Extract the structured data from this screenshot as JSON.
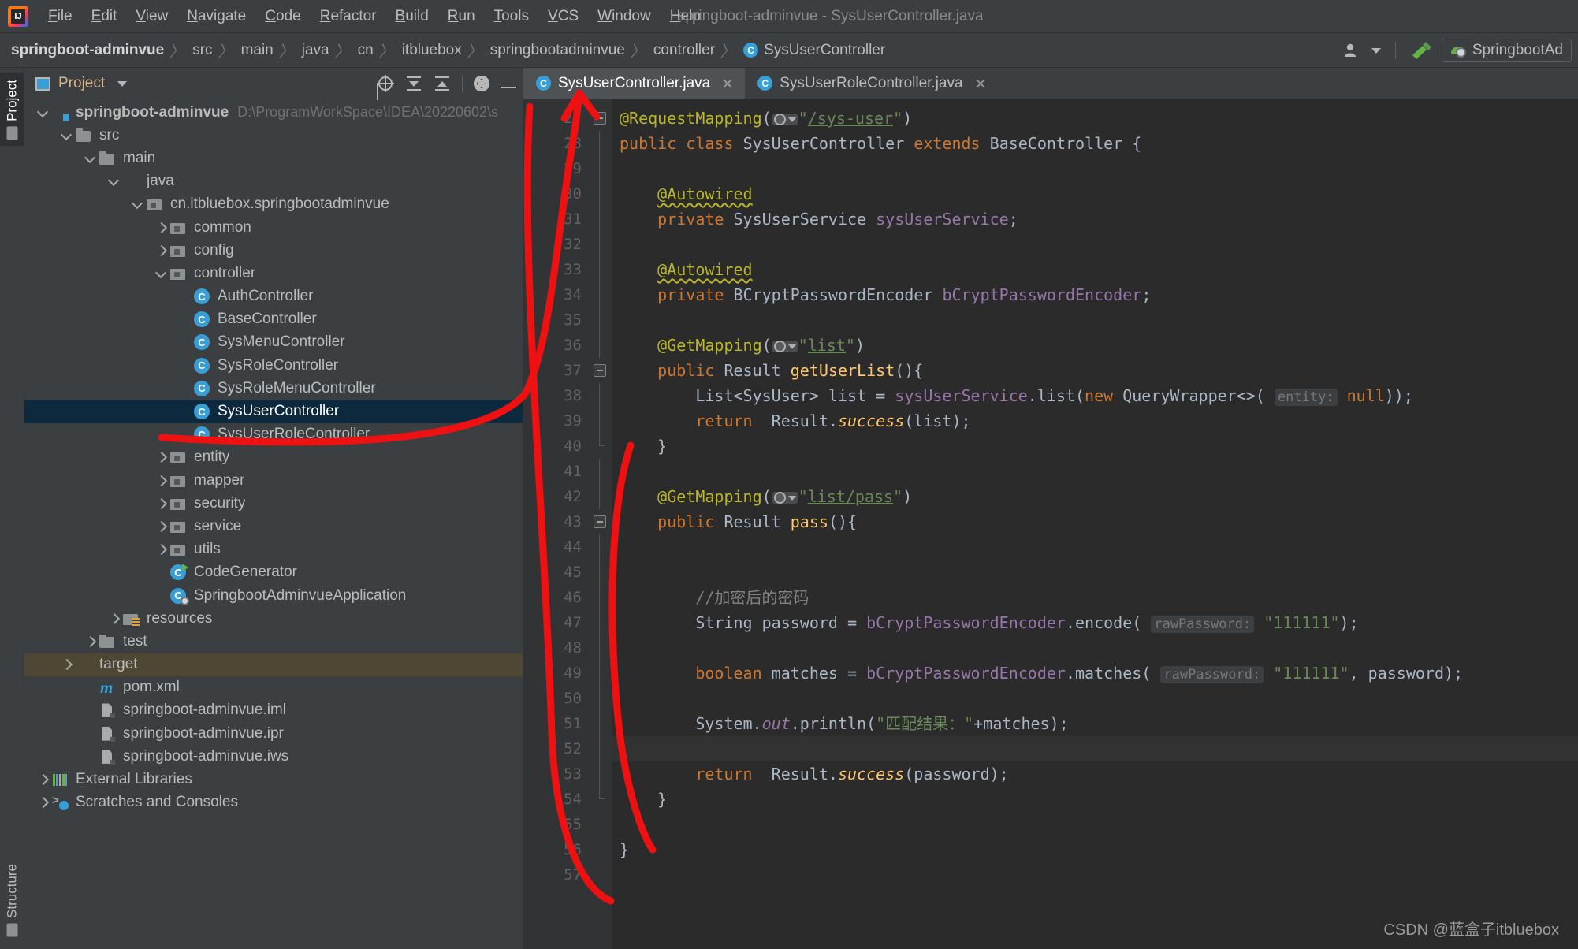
{
  "window": {
    "title": "springboot-adminvue - SysUserController.java",
    "logo_icon": "intellij-idea-logo"
  },
  "menu": [
    "File",
    "Edit",
    "View",
    "Navigate",
    "Code",
    "Refactor",
    "Build",
    "Run",
    "Tools",
    "VCS",
    "Window",
    "Help"
  ],
  "breadcrumb": [
    {
      "label": "springboot-adminvue",
      "icon": "",
      "root": true
    },
    {
      "label": "src",
      "icon": ""
    },
    {
      "label": "main",
      "icon": ""
    },
    {
      "label": "java",
      "icon": ""
    },
    {
      "label": "cn",
      "icon": ""
    },
    {
      "label": "itbluebox",
      "icon": ""
    },
    {
      "label": "springbootadminvue",
      "icon": ""
    },
    {
      "label": "controller",
      "icon": ""
    },
    {
      "label": "SysUserController",
      "icon": "class-icon"
    }
  ],
  "navbar_right": {
    "user_icon": "user-account-icon",
    "build_icon": "hammer-build-icon",
    "run_config": "SpringbootAd"
  },
  "tool_tabs": {
    "project": "Project",
    "structure": "Structure"
  },
  "project_panel": {
    "title": "Project",
    "tools": [
      {
        "name": "locate-icon"
      },
      {
        "name": "expand-all-icon"
      },
      {
        "name": "collapse-all-icon"
      },
      {
        "name": "settings-gear-icon"
      },
      {
        "name": "hide-panel-icon"
      }
    ],
    "tree": [
      {
        "depth": 0,
        "arrow": "d",
        "icon": "folder-mod",
        "label": "springboot-adminvue",
        "bold": true,
        "path": "D:\\ProgramWorkSpace\\IDEA\\20220602\\s",
        "state": ""
      },
      {
        "depth": 1,
        "arrow": "d",
        "icon": "folder",
        "label": "src",
        "state": ""
      },
      {
        "depth": 2,
        "arrow": "d",
        "icon": "folder",
        "label": "main",
        "state": ""
      },
      {
        "depth": 3,
        "arrow": "d",
        "icon": "folder-src",
        "label": "java",
        "state": ""
      },
      {
        "depth": 4,
        "arrow": "d",
        "icon": "pkg",
        "label": "cn.itbluebox.springbootadminvue",
        "state": ""
      },
      {
        "depth": 5,
        "arrow": "r",
        "icon": "pkg",
        "label": "common",
        "state": ""
      },
      {
        "depth": 5,
        "arrow": "r",
        "icon": "pkg",
        "label": "config",
        "state": ""
      },
      {
        "depth": 5,
        "arrow": "d",
        "icon": "pkg",
        "label": "controller",
        "state": ""
      },
      {
        "depth": 6,
        "arrow": "none",
        "icon": "cls",
        "label": "AuthController",
        "state": ""
      },
      {
        "depth": 6,
        "arrow": "none",
        "icon": "cls",
        "label": "BaseController",
        "state": ""
      },
      {
        "depth": 6,
        "arrow": "none",
        "icon": "cls",
        "label": "SysMenuController",
        "state": ""
      },
      {
        "depth": 6,
        "arrow": "none",
        "icon": "cls",
        "label": "SysRoleController",
        "state": ""
      },
      {
        "depth": 6,
        "arrow": "none",
        "icon": "cls",
        "label": "SysRoleMenuController",
        "state": ""
      },
      {
        "depth": 6,
        "arrow": "none",
        "icon": "cls",
        "label": "SysUserController",
        "state": "selected"
      },
      {
        "depth": 6,
        "arrow": "none",
        "icon": "cls",
        "label": "SysUserRoleController",
        "state": ""
      },
      {
        "depth": 5,
        "arrow": "r",
        "icon": "pkg",
        "label": "entity",
        "state": ""
      },
      {
        "depth": 5,
        "arrow": "r",
        "icon": "pkg",
        "label": "mapper",
        "state": ""
      },
      {
        "depth": 5,
        "arrow": "r",
        "icon": "pkg",
        "label": "security",
        "state": ""
      },
      {
        "depth": 5,
        "arrow": "r",
        "icon": "pkg",
        "label": "service",
        "state": ""
      },
      {
        "depth": 5,
        "arrow": "r",
        "icon": "pkg",
        "label": "utils",
        "state": ""
      },
      {
        "depth": 5,
        "arrow": "none",
        "icon": "cls-runnable",
        "label": "CodeGenerator",
        "state": ""
      },
      {
        "depth": 5,
        "arrow": "none",
        "icon": "cls-spring",
        "label": "SpringbootAdminvueApplication",
        "state": ""
      },
      {
        "depth": 3,
        "arrow": "r",
        "icon": "res",
        "label": "resources",
        "state": ""
      },
      {
        "depth": 2,
        "arrow": "r",
        "icon": "folder",
        "label": "test",
        "state": ""
      },
      {
        "depth": 1,
        "arrow": "r",
        "icon": "folder-target",
        "label": "target",
        "state": "highlight"
      },
      {
        "depth": 2,
        "arrow": "none",
        "icon": "maven",
        "label": "pom.xml",
        "state": ""
      },
      {
        "depth": 2,
        "arrow": "none",
        "icon": "file",
        "label": "springboot-adminvue.iml",
        "state": ""
      },
      {
        "depth": 2,
        "arrow": "none",
        "icon": "file",
        "label": "springboot-adminvue.ipr",
        "state": ""
      },
      {
        "depth": 2,
        "arrow": "none",
        "icon": "file",
        "label": "springboot-adminvue.iws",
        "state": ""
      },
      {
        "depth": 0,
        "arrow": "r",
        "icon": "libs",
        "label": "External Libraries",
        "state": ""
      },
      {
        "depth": 0,
        "arrow": "r",
        "icon": "scr",
        "label": "Scratches and Consoles",
        "state": ""
      }
    ]
  },
  "editor": {
    "tabs": [
      {
        "label": "SysUserController.java",
        "icon": "class-icon",
        "active": true,
        "closable": true
      },
      {
        "label": "SysUserRoleController.java",
        "icon": "class-icon",
        "active": false,
        "closable": true
      }
    ],
    "first_line_number": 27,
    "caret_line": 52,
    "lines": [
      {
        "n": 27,
        "marker": "",
        "fold": "minus",
        "html": "<span class=\"ann\">@RequestMapping</span>(<span class=\"globe\"><span class=\"g1\"></span><span class=\"g2\"></span></span><span class=\"str\">\"</span><span class=\"strl\">/sys-user</span><span class=\"str\">\"</span>)"
      },
      {
        "n": 28,
        "marker": "bean",
        "fold": "bar",
        "html": "<span class=\"kw\">public</span> <span class=\"kw\">class</span> <span class=\"typ\">SysUserController</span> <span class=\"kw\">extends</span> <span class=\"typ\">BaseController</span> {"
      },
      {
        "n": 29,
        "marker": "",
        "fold": "bar",
        "html": ""
      },
      {
        "n": 30,
        "marker": "",
        "fold": "bar",
        "html": "    <span class=\"annu\">@Autowired</span>"
      },
      {
        "n": 31,
        "marker": "green",
        "fold": "bar",
        "html": "    <span class=\"kw\">private</span> <span class=\"typ\">SysUserService</span> <span class=\"fld\">sysUserService</span>;"
      },
      {
        "n": 32,
        "marker": "",
        "fold": "bar",
        "html": ""
      },
      {
        "n": 33,
        "marker": "",
        "fold": "bar",
        "html": "    <span class=\"annu\">@Autowired</span>"
      },
      {
        "n": 34,
        "marker": "green",
        "fold": "bar",
        "html": "    <span class=\"kw\">private</span> <span class=\"typ\">BCryptPasswordEncoder</span> <span class=\"fld\">bCryptPasswordEncoder</span>;"
      },
      {
        "n": 35,
        "marker": "",
        "fold": "bar",
        "html": ""
      },
      {
        "n": 36,
        "marker": "",
        "fold": "bar",
        "html": "    <span class=\"ann\">@GetMapping</span>(<span class=\"globe\"><span class=\"g1\"></span><span class=\"g2\"></span></span><span class=\"str\">\"</span><span class=\"strl\">list</span><span class=\"str\">\"</span>)"
      },
      {
        "n": 37,
        "marker": "green",
        "fold": "minus",
        "html": "    <span class=\"kw\">public</span> <span class=\"typ\">Result</span> <span class=\"mth\">getUserList</span>(){"
      },
      {
        "n": 38,
        "marker": "",
        "fold": "bar",
        "html": "        <span class=\"typ\">List&lt;SysUser&gt;</span> list = <span class=\"fld\">sysUserService</span>.<span class=\"typ\">list</span>(<span class=\"kw\">new</span> <span class=\"typ\">QueryWrapper</span>&lt;&gt;( <span class=\"hint\">entity:</span> <span class=\"kw\">null</span>));"
      },
      {
        "n": 39,
        "marker": "",
        "fold": "bar",
        "html": "        <span class=\"kw\">return</span>  <span class=\"typ\">Result</span>.<span class=\"mthi\">success</span>(list);"
      },
      {
        "n": 40,
        "marker": "",
        "fold": "end",
        "html": "    }"
      },
      {
        "n": 41,
        "marker": "",
        "fold": "bar",
        "html": ""
      },
      {
        "n": 42,
        "marker": "",
        "fold": "bar",
        "html": "    <span class=\"ann\">@GetMapping</span>(<span class=\"globe\"><span class=\"g1\"></span><span class=\"g2\"></span></span><span class=\"str\">\"</span><span class=\"strl\">list/pass</span><span class=\"str\">\"</span>)"
      },
      {
        "n": 43,
        "marker": "bean",
        "fold": "minus",
        "html": "    <span class=\"kw\">public</span> <span class=\"typ\">Result</span> <span class=\"mth\">pass</span>(){"
      },
      {
        "n": 44,
        "marker": "",
        "fold": "bar",
        "html": ""
      },
      {
        "n": 45,
        "marker": "",
        "fold": "bar",
        "html": ""
      },
      {
        "n": 46,
        "marker": "",
        "fold": "bar",
        "html": "        <span class=\"cmt\">//加密后的密码</span>"
      },
      {
        "n": 47,
        "marker": "",
        "fold": "bar",
        "html": "        <span class=\"typ\">String</span> password = <span class=\"fld\">bCryptPasswordEncoder</span>.<span class=\"typ\">encode</span>( <span class=\"hint\">rawPassword:</span> <span class=\"str\">\"111111\"</span>);"
      },
      {
        "n": 48,
        "marker": "",
        "fold": "bar",
        "html": ""
      },
      {
        "n": 49,
        "marker": "",
        "fold": "bar",
        "html": "        <span class=\"kw\">boolean</span> matches = <span class=\"fld\">bCryptPasswordEncoder</span>.<span class=\"typ\">matches</span>( <span class=\"hint\">rawPassword:</span> <span class=\"str\">\"111111\"</span>, password);"
      },
      {
        "n": 50,
        "marker": "",
        "fold": "bar",
        "html": ""
      },
      {
        "n": 51,
        "marker": "",
        "fold": "bar",
        "html": "        <span class=\"typ\">System</span>.<span class=\"stat\">out</span>.<span class=\"typ\">println</span>(<span class=\"str\">\"匹配结果：\"</span>+matches);"
      },
      {
        "n": 52,
        "marker": "",
        "fold": "bar",
        "html": "",
        "caret": true
      },
      {
        "n": 53,
        "marker": "",
        "fold": "bar",
        "html": "        <span class=\"kw\">return</span>  <span class=\"typ\">Result</span>.<span class=\"mthi\">success</span>(password);"
      },
      {
        "n": 54,
        "marker": "",
        "fold": "end",
        "html": "    }"
      },
      {
        "n": 55,
        "marker": "",
        "fold": "",
        "html": ""
      },
      {
        "n": 56,
        "marker": "",
        "fold": "",
        "html": "}"
      },
      {
        "n": 57,
        "marker": "",
        "fold": "",
        "html": ""
      }
    ]
  },
  "annotation": {
    "color": "#ee1111",
    "description": "red-hand-drawn-arrow-and-bracket"
  },
  "watermark": "CSDN @蓝盒子itbluebox"
}
